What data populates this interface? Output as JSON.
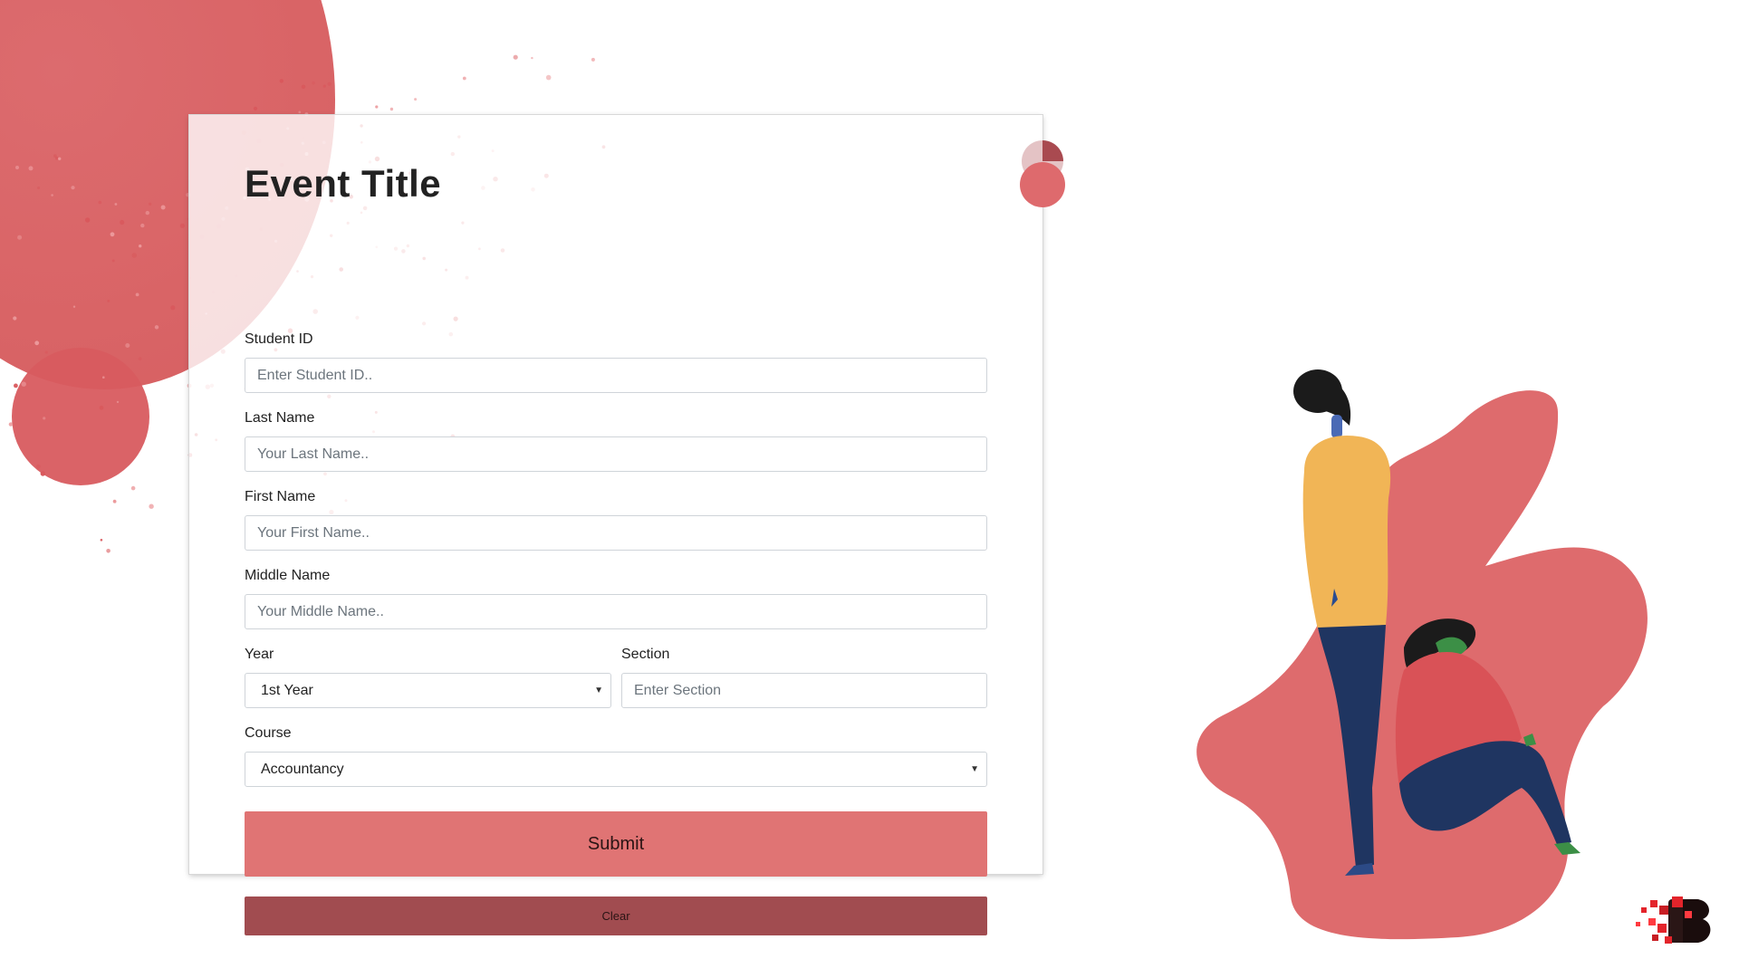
{
  "form": {
    "title": "Event Title",
    "student_id": {
      "label": "Student ID",
      "placeholder": "Enter Student ID.."
    },
    "last_name": {
      "label": "Last Name",
      "placeholder": "Your Last Name.."
    },
    "first_name": {
      "label": "First Name",
      "placeholder": "Your First Name.."
    },
    "middle_name": {
      "label": "Middle Name",
      "placeholder": "Your Middle Name.."
    },
    "year": {
      "label": "Year",
      "value": "1st Year"
    },
    "section": {
      "label": "Section",
      "placeholder": "Enter Section"
    },
    "course": {
      "label": "Course",
      "value": "Accountancy"
    },
    "submit_label": "Submit",
    "clear_label": "Clear"
  },
  "icons": {
    "dropdown": "chevron-down-icon"
  },
  "colors": {
    "accent": "#e07474",
    "accent_dark": "#a14c50",
    "blob": "#d96466",
    "shirt": "#f1b556",
    "pants": "#1f3561",
    "hair": "#1b1b1b"
  }
}
